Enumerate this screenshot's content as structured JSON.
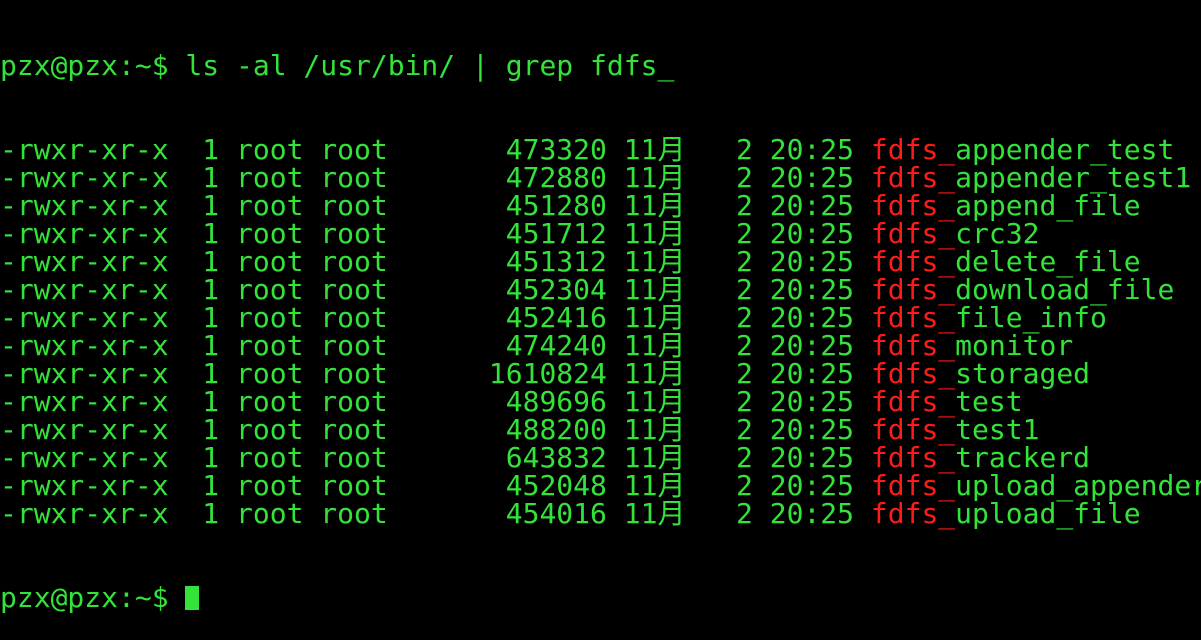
{
  "colors": {
    "background": "#000000",
    "text": "#33e33a",
    "highlight": "#ff1a1a"
  },
  "command_line": "pzx@pzx:~$ ls -al /usr/bin/ | grep fdfs_",
  "match": "fdfs_",
  "entries": [
    {
      "prefix": "-rwxr-xr-x  1 root root       473320 11月   2 20:25 ",
      "suffix": "appender_test"
    },
    {
      "prefix": "-rwxr-xr-x  1 root root       472880 11月   2 20:25 ",
      "suffix": "appender_test1"
    },
    {
      "prefix": "-rwxr-xr-x  1 root root       451280 11月   2 20:25 ",
      "suffix": "append_file"
    },
    {
      "prefix": "-rwxr-xr-x  1 root root       451712 11月   2 20:25 ",
      "suffix": "crc32"
    },
    {
      "prefix": "-rwxr-xr-x  1 root root       451312 11月   2 20:25 ",
      "suffix": "delete_file"
    },
    {
      "prefix": "-rwxr-xr-x  1 root root       452304 11月   2 20:25 ",
      "suffix": "download_file"
    },
    {
      "prefix": "-rwxr-xr-x  1 root root       452416 11月   2 20:25 ",
      "suffix": "file_info"
    },
    {
      "prefix": "-rwxr-xr-x  1 root root       474240 11月   2 20:25 ",
      "suffix": "monitor"
    },
    {
      "prefix": "-rwxr-xr-x  1 root root      1610824 11月   2 20:25 ",
      "suffix": "storaged"
    },
    {
      "prefix": "-rwxr-xr-x  1 root root       489696 11月   2 20:25 ",
      "suffix": "test"
    },
    {
      "prefix": "-rwxr-xr-x  1 root root       488200 11月   2 20:25 ",
      "suffix": "test1"
    },
    {
      "prefix": "-rwxr-xr-x  1 root root       643832 11月   2 20:25 ",
      "suffix": "trackerd"
    },
    {
      "prefix": "-rwxr-xr-x  1 root root       452048 11月   2 20:25 ",
      "suffix": "upload_appender"
    },
    {
      "prefix": "-rwxr-xr-x  1 root root       454016 11月   2 20:25 ",
      "suffix": "upload_file"
    }
  ],
  "next_prompt": "pzx@pzx:~$ "
}
